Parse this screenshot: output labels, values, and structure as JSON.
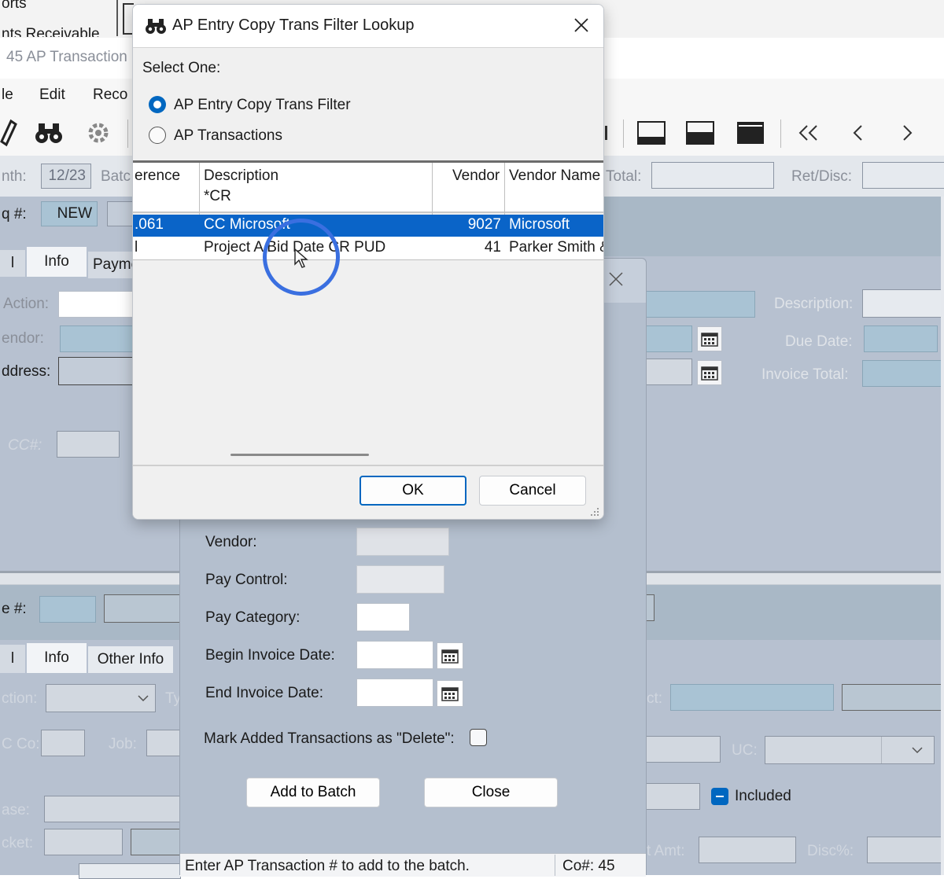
{
  "background": {
    "top_bar_texts": [
      "orts",
      "nts Receivable"
    ],
    "window_title": "45 AP Transaction",
    "menu": [
      "le",
      "Edit",
      "Reco"
    ],
    "left_form": {
      "month_label": "nth:",
      "month_value": "12/23",
      "batch_label": "Batc",
      "seq_label": "q #:",
      "seq_value": "NEW",
      "tabs": [
        "l",
        "Info",
        "Payme"
      ],
      "action_label": "Action:",
      "vendor_label": "endor:",
      "address_label": "ddress:",
      "cc_label": "CC#:"
    },
    "right_form": {
      "total_label": "Total:",
      "ret_disc_label": "Ret/Disc:",
      "description_label": "Description:",
      "due_date_label": "Due Date:",
      "invoice_total_label": "Invoice Total:"
    },
    "lower_form": {
      "line_label": "e #:",
      "tabs": [
        "l",
        "Info",
        "Other Info"
      ],
      "action_label": "ction:",
      "ty_label": "Ty",
      "co_label": "C Co:",
      "job_label": "Job:",
      "phase_label": "ase:",
      "ticket_label": "cket:",
      "ct_label": "ct:",
      "uc_label": "UC:",
      "included_label": "Included",
      "amt_label": "t Amt:",
      "disc_label": "Disc%:"
    }
  },
  "batch_dialog": {
    "vendor_label": "Vendor:",
    "pay_control_label": "Pay Control:",
    "pay_category_label": "Pay Category:",
    "begin_invoice_label": "Begin Invoice Date:",
    "end_invoice_label": "End Invoice Date:",
    "mark_delete_label": "Mark Added Transactions as \"Delete\":",
    "add_to_batch": "Add to Batch",
    "close": "Close",
    "status_text": "Enter AP Transaction # to add to the batch.",
    "company": "Co#: 45"
  },
  "lookup_dialog": {
    "title": "AP Entry Copy Trans Filter Lookup",
    "select_one": "Select One:",
    "options": [
      {
        "label": "AP Entry Copy Trans Filter",
        "selected": true
      },
      {
        "label": "AP Transactions",
        "selected": false
      }
    ],
    "columns": {
      "reference": "erence",
      "description": "Description",
      "vendor": "Vendor",
      "vendor_name": "Vendor Name"
    },
    "filter_description": "*CR",
    "rows": [
      {
        "reference": ".061",
        "description": "CC Microsoft",
        "vendor": "9027",
        "vendor_name": "Microsoft",
        "selected": true
      },
      {
        "reference": "l",
        "description": "Project A Bid Date CR PUD",
        "vendor": "41",
        "vendor_name": "Parker Smith &",
        "selected": false
      }
    ],
    "ok": "OK",
    "cancel": "Cancel"
  },
  "colors": {
    "accent": "#0067c0",
    "selection": "#0a64c8",
    "field_blue": "#a9c3d4",
    "panel": "#b7c1d0"
  }
}
